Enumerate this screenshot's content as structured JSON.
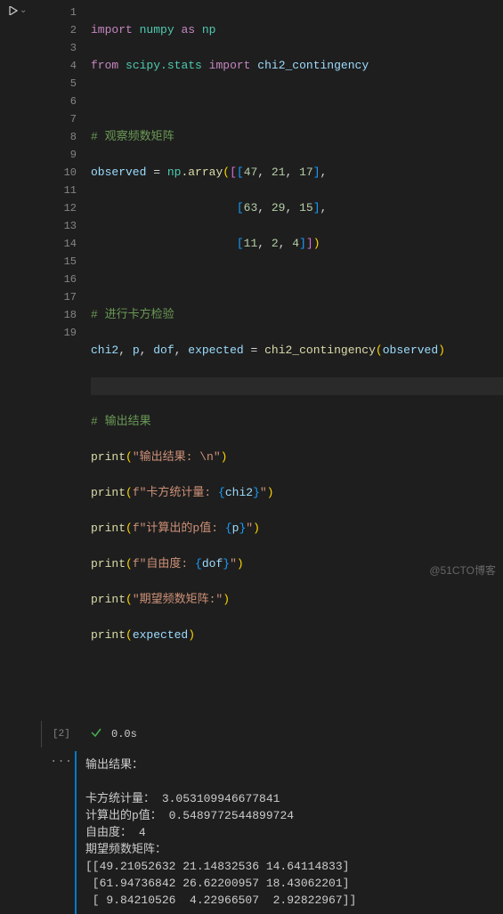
{
  "exec_count": "[2]",
  "status_time": "0.0s",
  "line_numbers": [
    "1",
    "2",
    "3",
    "4",
    "5",
    "6",
    "7",
    "8",
    "9",
    "10",
    "11",
    "12",
    "13",
    "14",
    "15",
    "16",
    "17",
    "18",
    "19"
  ],
  "code": {
    "l1": {
      "import": "import",
      "numpy": "numpy",
      "as": "as",
      "np": "np"
    },
    "l2": {
      "from": "from",
      "scipy": "scipy.stats",
      "import": "import",
      "chi2": "chi2_contingency"
    },
    "l4": "# 观察频数矩阵",
    "l5": {
      "observed": "observed",
      "eq": " = ",
      "np": "np",
      "array": ".array",
      "n1": "47",
      "n2": "21",
      "n3": "17"
    },
    "l6": {
      "n1": "63",
      "n2": "29",
      "n3": "15"
    },
    "l7": {
      "n1": "11",
      "n2": "2",
      "n3": "4"
    },
    "l9": "# 进行卡方检验",
    "l10": {
      "chi2": "chi2",
      "p": "p",
      "dof": "dof",
      "expected": "expected",
      "eq": " = ",
      "fn": "chi2_contingency",
      "arg": "observed"
    },
    "l12": "# 输出结果",
    "l13": {
      "print": "print",
      "s": "\"输出结果: \\n\""
    },
    "l14": {
      "print": "print",
      "pre": "f\"卡方统计量: ",
      "expr": "{chi2}",
      "post": "\""
    },
    "l15": {
      "print": "print",
      "pre": "f\"计算出的p值: ",
      "expr": "{p}",
      "post": "\""
    },
    "l16": {
      "print": "print",
      "pre": "f\"自由度: ",
      "expr": "{dof}",
      "post": "\""
    },
    "l17": {
      "print": "print",
      "s": "\"期望频数矩阵:\""
    },
    "l18": {
      "print": "print",
      "arg": "expected"
    }
  },
  "output": {
    "title": "输出结果：",
    "chi2_label": "卡方统计量：",
    "chi2_val": "3.053109946677841",
    "p_label": "计算出的p值：",
    "p_val": "0.5489772544899724",
    "dof_label": "自由度：",
    "dof_val": "4",
    "matrix_label": "期望频数矩阵：",
    "row1": "[[49.21052632 21.14832536 14.64114833]",
    "row2": " [61.94736842 26.62200957 18.43062201]",
    "row3": " [ 9.84210526  4.22966507  2.92822967]]"
  },
  "watermark": "@51CTO博客"
}
